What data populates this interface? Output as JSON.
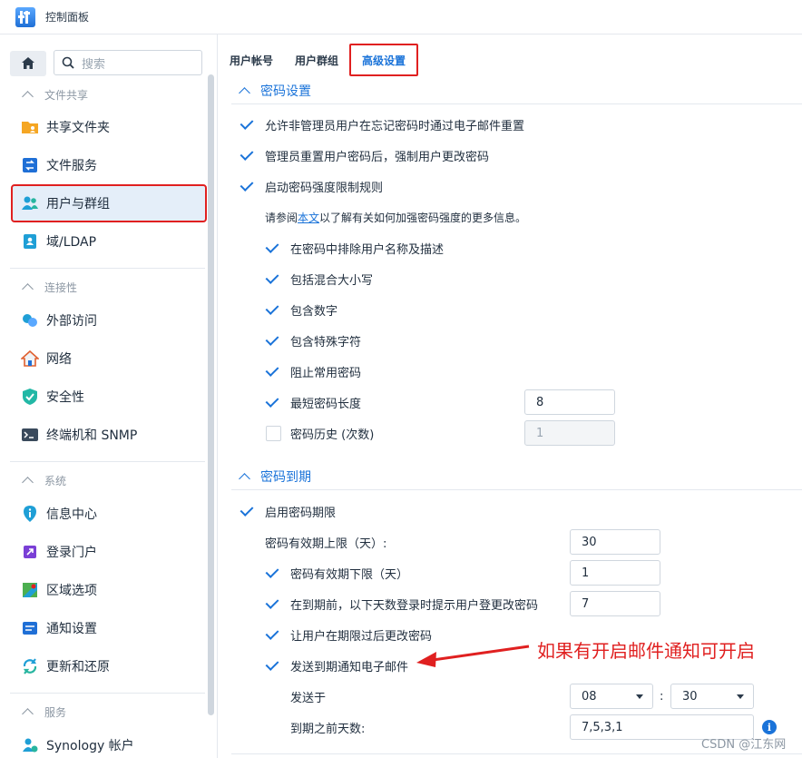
{
  "window": {
    "title": "控制面板"
  },
  "sidebar": {
    "search_placeholder": "搜索",
    "sections": [
      {
        "label": "文件共享",
        "items": [
          "共享文件夹",
          "文件服务",
          "用户与群组",
          "域/LDAP"
        ]
      },
      {
        "label": "连接性",
        "items": [
          "外部访问",
          "网络",
          "安全性",
          "终端机和 SNMP"
        ]
      },
      {
        "label": "系统",
        "items": [
          "信息中心",
          "登录门户",
          "区域选项",
          "通知设置",
          "更新和还原"
        ]
      },
      {
        "label": "服务",
        "items": [
          "Synology 帐户"
        ]
      }
    ],
    "active_item": "用户与群组"
  },
  "tabs": [
    "用户帐号",
    "用户群组",
    "高级设置"
  ],
  "active_tab": "高级设置",
  "password_settings": {
    "title": "密码设置",
    "allow_reset": {
      "label": "允许非管理员用户在忘记密码时通过电子邮件重置",
      "checked": true
    },
    "force_change": {
      "label": "管理员重置用户密码后，强制用户更改密码",
      "checked": true
    },
    "strength_rules": {
      "label": "启动密码强度限制规则",
      "checked": true
    },
    "hint_prefix": "请参阅",
    "hint_link": "本文",
    "hint_suffix": "以了解有关如何加强密码强度的更多信息。",
    "rules": [
      {
        "label": "在密码中排除用户名称及描述",
        "checked": true
      },
      {
        "label": "包括混合大小写",
        "checked": true
      },
      {
        "label": "包含数字",
        "checked": true
      },
      {
        "label": "包含特殊字符",
        "checked": true
      },
      {
        "label": "阻止常用密码",
        "checked": true
      }
    ],
    "min_length": {
      "label": "最短密码长度",
      "checked": true,
      "value": "8"
    },
    "history": {
      "label": "密码历史 (次数)",
      "checked": false,
      "value": "1"
    }
  },
  "password_expiry": {
    "title": "密码到期",
    "enable": {
      "label": "启用密码期限",
      "checked": true
    },
    "max_age": {
      "label": "密码有效期上限（天）:",
      "value": "30"
    },
    "min_age": {
      "label": "密码有效期下限（天）",
      "checked": true,
      "value": "1"
    },
    "prompt_days": {
      "label": "在到期前，以下天数登录时提示用户登更改密码",
      "checked": true,
      "value": "7"
    },
    "allow_after": {
      "label": "让用户在期限过后更改密码",
      "checked": true
    },
    "send_email": {
      "label": "发送到期通知电子邮件",
      "checked": true
    },
    "send_at": {
      "label": "发送于",
      "hour": "08",
      "sep": ":",
      "minute": "30"
    },
    "days_before": {
      "label": "到期之前天数:",
      "value": "7,5,3,1"
    }
  },
  "annotation": "如果有开启邮件通知可开启",
  "watermark": "CSDN @江东网"
}
